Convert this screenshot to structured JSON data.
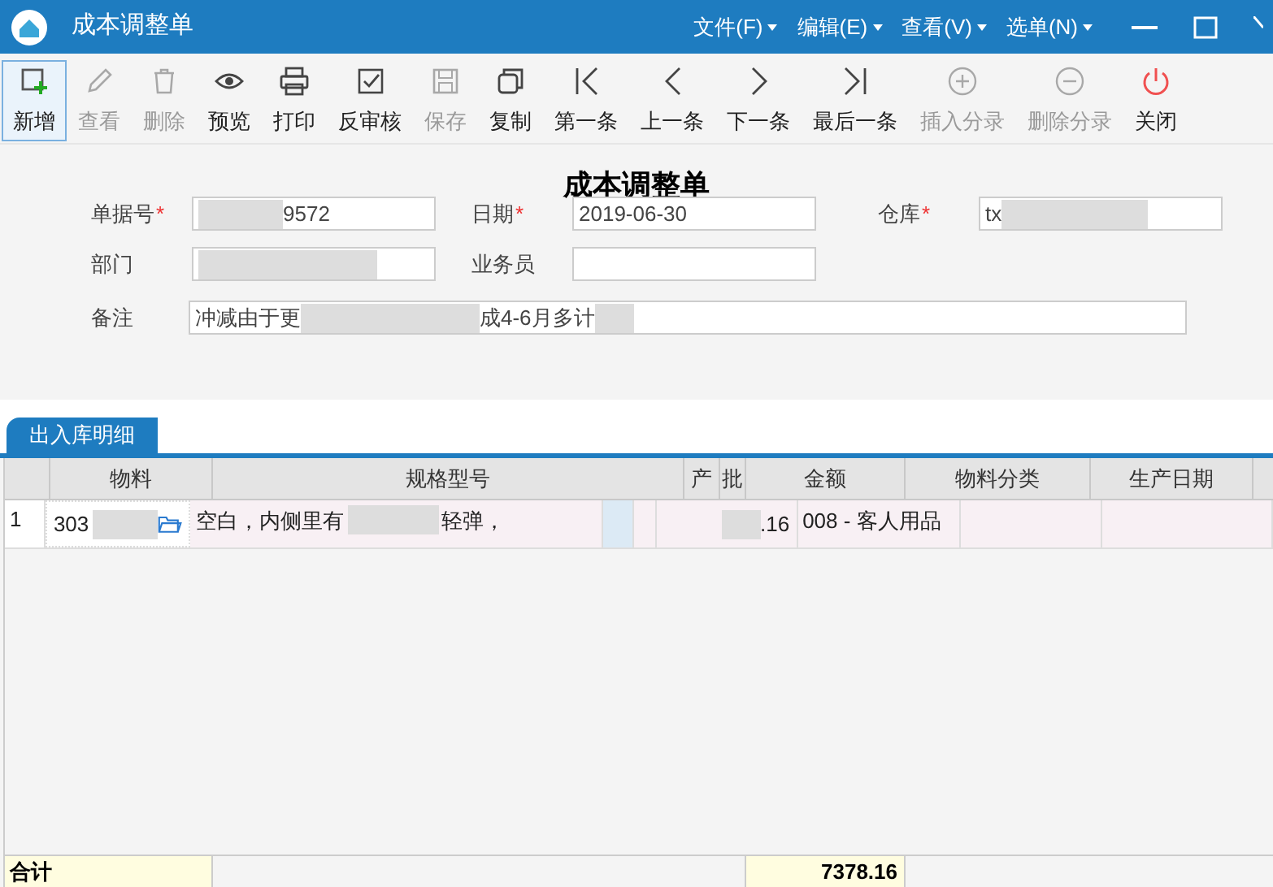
{
  "window": {
    "title": "成本调整单"
  },
  "menus": [
    {
      "label": "文件(F)"
    },
    {
      "label": "编辑(E)"
    },
    {
      "label": "查看(V)"
    },
    {
      "label": "选单(N)"
    }
  ],
  "toolbar": [
    {
      "label": "新增",
      "kind": "add",
      "selected": true,
      "disabled": false
    },
    {
      "label": "查看",
      "kind": "edit",
      "selected": false,
      "disabled": true
    },
    {
      "label": "删除",
      "kind": "trash",
      "selected": false,
      "disabled": true
    },
    {
      "label": "预览",
      "kind": "eye",
      "selected": false,
      "disabled": false
    },
    {
      "label": "打印",
      "kind": "print",
      "selected": false,
      "disabled": false
    },
    {
      "label": "反审核",
      "kind": "check",
      "selected": false,
      "disabled": false
    },
    {
      "label": "保存",
      "kind": "save",
      "selected": false,
      "disabled": true
    },
    {
      "label": "复制",
      "kind": "copy",
      "selected": false,
      "disabled": false
    },
    {
      "label": "第一条",
      "kind": "first",
      "selected": false,
      "disabled": false
    },
    {
      "label": "上一条",
      "kind": "prev",
      "selected": false,
      "disabled": false
    },
    {
      "label": "下一条",
      "kind": "next",
      "selected": false,
      "disabled": false
    },
    {
      "label": "最后一条",
      "kind": "last",
      "selected": false,
      "disabled": false
    },
    {
      "label": "插入分录",
      "kind": "plus",
      "selected": false,
      "disabled": true
    },
    {
      "label": "删除分录",
      "kind": "minus",
      "selected": false,
      "disabled": true
    },
    {
      "label": "关闭",
      "kind": "power",
      "selected": false,
      "disabled": false
    }
  ],
  "form": {
    "title": "成本调整单",
    "fields": [
      {
        "label": "单据号",
        "required_mark": "*",
        "value": "9572",
        "blurred": true
      },
      {
        "label": "日期",
        "required_mark": "*",
        "value": "2019-06-30",
        "blurred": false
      },
      {
        "label": "仓库",
        "required_mark": "*",
        "value": "tx",
        "blurred": true
      },
      {
        "label": "部门",
        "blurred": true
      },
      {
        "label": "业务员",
        "blurred": false
      }
    ],
    "remark": {
      "label": "备注",
      "value_start": "冲减由于更",
      "value_end": "成4-6月多计"
    }
  },
  "tabs": [
    {
      "label": "出入库明细",
      "selected": true
    }
  ],
  "table": {
    "columns": [
      "物料",
      "规格型号",
      "产",
      "批",
      "金额",
      "物料分类",
      "生产日期"
    ],
    "rows": [
      {
        "index": "1",
        "material": "303",
        "spec_start": "空白，内侧里有",
        "spec_end": "轻弹，",
        "amount": ".16",
        "category": "008 - 客人用品"
      }
    ],
    "total": {
      "label": "合计",
      "amount": "7378.16"
    }
  }
}
